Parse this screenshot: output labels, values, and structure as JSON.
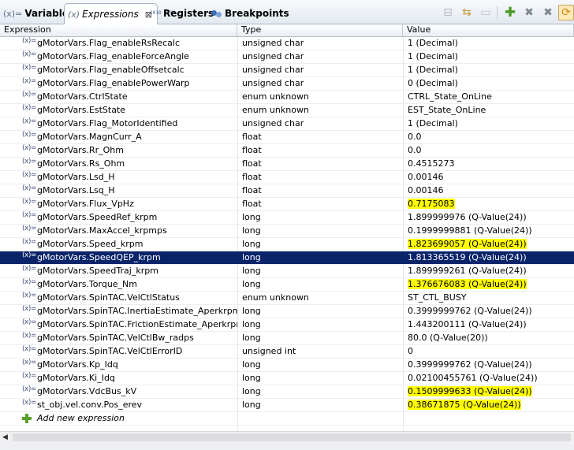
{
  "tabs": [
    {
      "icon": "(x)=",
      "label": "Variables"
    },
    {
      "icon": "(x)",
      "label": "Expressions",
      "close": "⊠"
    },
    {
      "icon": "1010 0101",
      "label": "Registers"
    },
    {
      "icon": "breakpoint",
      "label": "Breakpoints"
    }
  ],
  "columns": {
    "expression": "Expression",
    "type": "Type",
    "value": "Value"
  },
  "rows": [
    {
      "expression": "gMotorVars.Flag_enableRsRecalc",
      "type": "unsigned char",
      "value": "1 (Decimal)"
    },
    {
      "expression": "gMotorVars.Flag_enableForceAngle",
      "type": "unsigned char",
      "value": "1 (Decimal)"
    },
    {
      "expression": "gMotorVars.Flag_enableOffsetcalc",
      "type": "unsigned char",
      "value": "1 (Decimal)"
    },
    {
      "expression": "gMotorVars.Flag_enablePowerWarp",
      "type": "unsigned char",
      "value": "0 (Decimal)"
    },
    {
      "expression": "gMotorVars.CtrlState",
      "type": "enum unknown",
      "value": "CTRL_State_OnLine"
    },
    {
      "expression": "gMotorVars.EstState",
      "type": "enum unknown",
      "value": "EST_State_OnLine"
    },
    {
      "expression": "gMotorVars.Flag_MotorIdentified",
      "type": "unsigned char",
      "value": "1 (Decimal)"
    },
    {
      "expression": "gMotorVars.MagnCurr_A",
      "type": "float",
      "value": "0.0"
    },
    {
      "expression": "gMotorVars.Rr_Ohm",
      "type": "float",
      "value": "0.0"
    },
    {
      "expression": "gMotorVars.Rs_Ohm",
      "type": "float",
      "value": "0.4515273"
    },
    {
      "expression": "gMotorVars.Lsd_H",
      "type": "float",
      "value": "0.00146"
    },
    {
      "expression": "gMotorVars.Lsq_H",
      "type": "float",
      "value": "0.00146"
    },
    {
      "expression": "gMotorVars.Flux_VpHz",
      "type": "float",
      "value": "0.7175083",
      "highlight": true
    },
    {
      "expression": "gMotorVars.SpeedRef_krpm",
      "type": "long",
      "value": "1.899999976 (Q-Value(24))"
    },
    {
      "expression": "gMotorVars.MaxAccel_krpmps",
      "type": "long",
      "value": "0.1999999881 (Q-Value(24))"
    },
    {
      "expression": "gMotorVars.Speed_krpm",
      "type": "long",
      "value": "1.823699057 (Q-Value(24))",
      "highlight": true
    },
    {
      "expression": "gMotorVars.SpeedQEP_krpm",
      "type": "long",
      "value": "1.813365519 (Q-Value(24))",
      "selected": true
    },
    {
      "expression": "gMotorVars.SpeedTraj_krpm",
      "type": "long",
      "value": "1.899999261 (Q-Value(24))"
    },
    {
      "expression": "gMotorVars.Torque_Nm",
      "type": "long",
      "value": "1.376676083 (Q-Value(24))",
      "highlight": true
    },
    {
      "expression": "gMotorVars.SpinTAC.VelCtlStatus",
      "type": "enum unknown",
      "value": "ST_CTL_BUSY"
    },
    {
      "expression": "gMotorVars.SpinTAC.InertiaEstimate_Aperkrpm",
      "type": "long",
      "value": "0.3999999762 (Q-Value(24))"
    },
    {
      "expression": "gMotorVars.SpinTAC.FrictionEstimate_Aperkrpm",
      "type": "long",
      "value": "1.443200111 (Q-Value(24))"
    },
    {
      "expression": "gMotorVars.SpinTAC.VelCtlBw_radps",
      "type": "long",
      "value": "80.0 (Q-Value(20))"
    },
    {
      "expression": "gMotorVars.SpinTAC.VelCtlErrorID",
      "type": "unsigned int",
      "value": "0"
    },
    {
      "expression": "gMotorVars.Kp_Idq",
      "type": "long",
      "value": "0.3999999762 (Q-Value(24))"
    },
    {
      "expression": "gMotorVars.Ki_Idq",
      "type": "long",
      "value": "0.02100455761 (Q-Value(24))"
    },
    {
      "expression": "gMotorVars.VdcBus_kV",
      "type": "long",
      "value": "0.1509999633 (Q-Value(24))",
      "highlight": true
    },
    {
      "expression": "st_obj.vel.conv.Pos_erev",
      "type": "long",
      "value": "0.38671875 (Q-Value(24))",
      "highlight": true
    }
  ],
  "row_icon": "(x)=",
  "add_expression": "Add new expression",
  "status_text": "",
  "colors": {
    "highlight": "#ffff00",
    "selection": "#0a246a",
    "add_icon": "#5aa02c"
  },
  "toolbar_icons": [
    "collapse-all-icon",
    "link-icon",
    "minimize-icon",
    "add-expression-icon",
    "remove-expression-icon",
    "remove-all-icon",
    "continuous-refresh-icon"
  ]
}
